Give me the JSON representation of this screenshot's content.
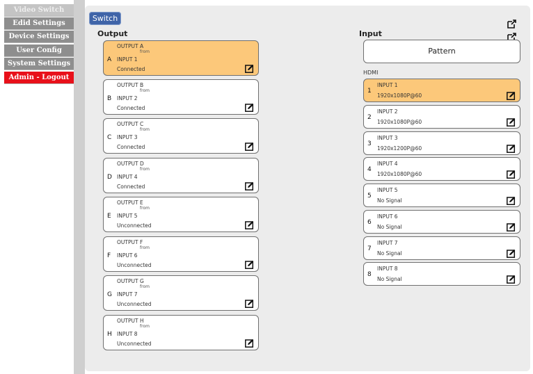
{
  "sidebar": {
    "items": [
      {
        "label": "Video Switch"
      },
      {
        "label": "Edid Settings"
      },
      {
        "label": "Device Settings"
      },
      {
        "label": "User Config"
      },
      {
        "label": "System Settings"
      },
      {
        "label": "Admin - Logout"
      }
    ]
  },
  "tab": {
    "label": "Switch"
  },
  "output": {
    "title": "Output",
    "from_label": "from",
    "cards": [
      {
        "letter": "A",
        "name": "OUTPUT A",
        "source": "INPUT 1",
        "status": "Connected",
        "selected": true
      },
      {
        "letter": "B",
        "name": "OUTPUT B",
        "source": "INPUT 2",
        "status": "Connected",
        "selected": false
      },
      {
        "letter": "C",
        "name": "OUTPUT C",
        "source": "INPUT 3",
        "status": "Connected",
        "selected": false
      },
      {
        "letter": "D",
        "name": "OUTPUT D",
        "source": "INPUT 4",
        "status": "Connected",
        "selected": false
      },
      {
        "letter": "E",
        "name": "OUTPUT E",
        "source": "INPUT 5",
        "status": "Unconnected",
        "selected": false
      },
      {
        "letter": "F",
        "name": "OUTPUT F",
        "source": "INPUT 6",
        "status": "Unconnected",
        "selected": false
      },
      {
        "letter": "G",
        "name": "OUTPUT G",
        "source": "INPUT 7",
        "status": "Unconnected",
        "selected": false
      },
      {
        "letter": "H",
        "name": "OUTPUT H",
        "source": "INPUT 8",
        "status": "Unconnected",
        "selected": false
      }
    ]
  },
  "input": {
    "title": "Input",
    "pattern_label": "Pattern",
    "group_label": "HDMI",
    "cards": [
      {
        "num": "1",
        "name": "INPUT 1",
        "signal": "1920x1080P@60",
        "selected": true
      },
      {
        "num": "2",
        "name": "INPUT 2",
        "signal": "1920x1080P@60",
        "selected": false
      },
      {
        "num": "3",
        "name": "INPUT 3",
        "signal": "1920x1200P@60",
        "selected": false
      },
      {
        "num": "4",
        "name": "INPUT 4",
        "signal": "1920x1080P@60",
        "selected": false
      },
      {
        "num": "5",
        "name": "INPUT 5",
        "signal": "No Signal",
        "selected": false
      },
      {
        "num": "6",
        "name": "INPUT 6",
        "signal": "No Signal",
        "selected": false
      },
      {
        "num": "7",
        "name": "INPUT 7",
        "signal": "No Signal",
        "selected": false
      },
      {
        "num": "8",
        "name": "INPUT 8",
        "signal": "No Signal",
        "selected": false
      }
    ]
  },
  "colors": {
    "selected_card": "#fcc87a",
    "tab": "#3f64a8",
    "logout": "#e8101a",
    "menu": "#8e8e8e"
  },
  "icons": {
    "edit": "edit-icon",
    "export": "export-icon"
  }
}
